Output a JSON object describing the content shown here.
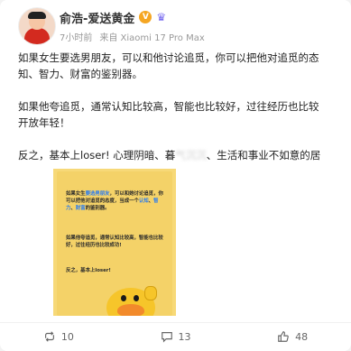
{
  "author": {
    "name": "俞浩-爱送黄金",
    "verified_badge": "V",
    "crown_icon": "crown-icon"
  },
  "meta": {
    "time": "7小时前",
    "source": "来自 Xiaomi 17 Pro Max"
  },
  "post": {
    "p1_line1": "如果女生要选男朋友，可以和他讨论追觅，你可以把他对追觅的态",
    "p1_line2": "知、智力、财富的鉴别器。",
    "p2_line1": "如果他夸追觅，通常认知比较高，智能也比较好，过往经历也比较",
    "p2_line2": "开放年轻！",
    "p3_prefix": "反之，基本上loser! 心理阴暗、暮",
    "p3_blur": "气沉沉",
    "p3_suffix": "、生活和事业不如意的居"
  },
  "image_card": {
    "block1_a": "如果女生",
    "block1_b": "要选男朋友",
    "block1_c": "，可以和她讨论追觅，你可以把他对追觅的态度，当成一个",
    "block1_d": "认知",
    "block1_e": "、",
    "block1_f": "智力",
    "block1_g": "、",
    "block1_h": "财富",
    "block1_i": "的鉴别器。",
    "block2": "如果他夸追觅，通常认知比较高，智能也比较好，过往经历也比较成功!",
    "block3": "反之，基本上loser!"
  },
  "actions": {
    "repost_count": "10",
    "comment_count": "13",
    "like_count": "48"
  },
  "colors": {
    "accent_blue": "#2a7bf0",
    "image_bg": "#f7d978"
  }
}
